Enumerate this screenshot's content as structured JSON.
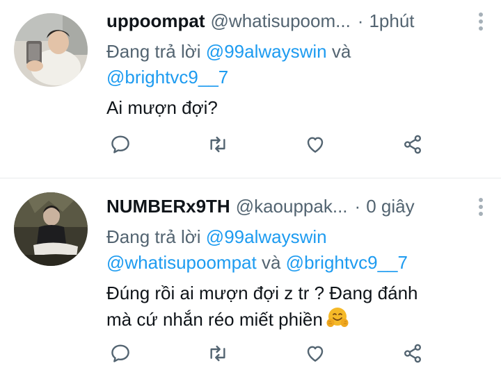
{
  "tweets": [
    {
      "display_name": "uppoompat",
      "handle": "@whatisupoom...",
      "separator": "·",
      "time": "1phút",
      "reply_prefix": "Đang trả lời",
      "mentions": [
        "@99alwayswin",
        "@brightvc9__7"
      ],
      "conjunction": "và",
      "text": "Ai mượn đợi?",
      "icons": {
        "avatar": "profile-photo",
        "more": "more-vertical-icon",
        "reply": "reply-icon",
        "retweet": "retweet-icon",
        "like": "heart-icon",
        "share": "share-icon"
      }
    },
    {
      "display_name": "NUMBERx9TH",
      "handle": "@kaouppak...",
      "separator": "·",
      "time": "0 giây",
      "reply_prefix": "Đang trả lời",
      "mentions": [
        "@99alwayswin",
        "@whatisupoompat",
        "@brightvc9__7"
      ],
      "conjunction": "và",
      "text_line1": "Đúng rồi ai mượn đợi z tr ? Đang đánh",
      "text_line2": "mà cứ nhắn réo miết phiền",
      "emoji": "hugging-face-emoji",
      "icons": {
        "avatar": "profile-photo",
        "more": "more-vertical-icon",
        "reply": "reply-icon",
        "retweet": "retweet-icon",
        "like": "heart-icon",
        "share": "share-icon"
      }
    }
  ],
  "colors": {
    "text": "#0f1419",
    "secondary": "#536471",
    "link": "#1d9bf0",
    "divider": "#e7eaec",
    "more_dots": "#a6b0b8"
  }
}
